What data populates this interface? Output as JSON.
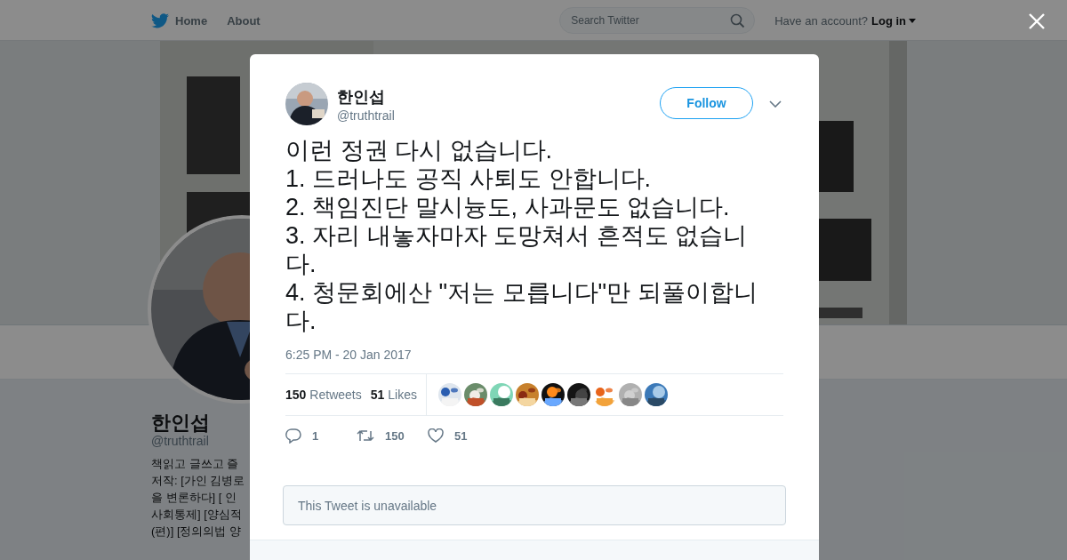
{
  "top_nav": {
    "items": [
      {
        "kind": "home",
        "label": "Home"
      },
      {
        "kind": "link",
        "label": "About"
      }
    ],
    "search": {
      "placeholder": "Search Twitter"
    },
    "account_prompt": "Have an account?",
    "login": "Log in"
  },
  "profile": {
    "name": "한인섭",
    "handle": "@truthtrail",
    "bio_lines": [
      "책읽고 글쓰고 즐",
      "저작: [가인 김병로",
      "을 변론하다] [ 인",
      "사회통제] [양심적",
      "(편)] [정의의법 양"
    ]
  },
  "tweet": {
    "author": {
      "name": "한인섭",
      "handle": "@truthtrail"
    },
    "follow_button": "Follow",
    "text": "이런 정권 다시 없습니다.\n1. 드러나도 공직 사퇴도 안합니다.\n2. 책임진단 말시늉도, 사과문도 없습니다.\n3. 자리 내놓자마자 도망쳐서 흔적도 없습니다.\n4. 청문회에산 \"저는 모릅니다\"만 되풀이합니다.",
    "timestamp": "6:25 PM - 20 Jan 2017",
    "stats": [
      {
        "count": "150",
        "label": "Retweets"
      },
      {
        "count": "51",
        "label": "Likes"
      }
    ],
    "actions": [
      {
        "kind": "reply",
        "count": "1"
      },
      {
        "kind": "retweet",
        "count": "150"
      },
      {
        "kind": "like",
        "count": "51"
      }
    ],
    "quoted_tweet": "This Tweet is unavailable"
  }
}
